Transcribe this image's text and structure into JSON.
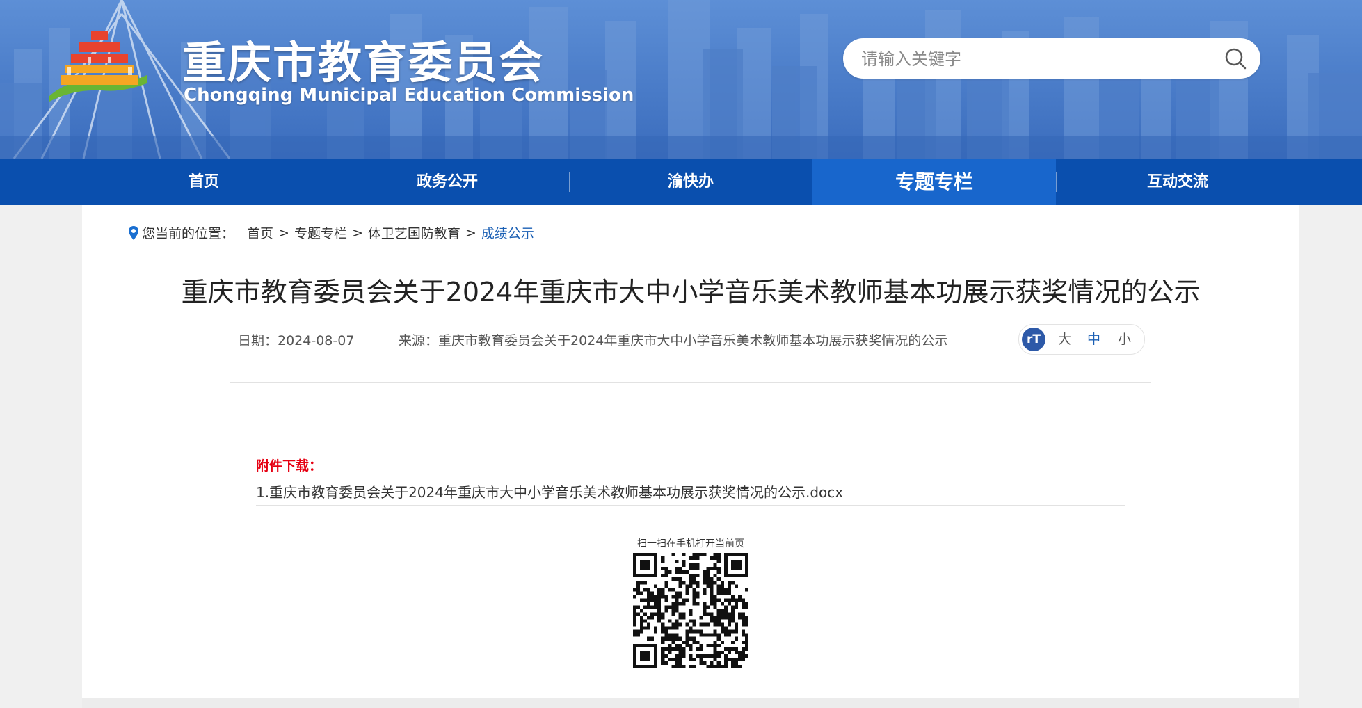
{
  "header": {
    "title": "重庆市教育委员会",
    "subtitle": "Chongqing Municipal Education Commission",
    "search_placeholder": "请输入关键字"
  },
  "nav": {
    "items": [
      {
        "label": "首页"
      },
      {
        "label": "政务公开"
      },
      {
        "label": "渝快办"
      },
      {
        "label": "专题专栏",
        "active": true
      },
      {
        "label": "互动交流"
      }
    ]
  },
  "breadcrumb": {
    "label": "您当前的位置：",
    "items": [
      "首页",
      "专题专栏",
      "体卫艺国防教育",
      "成绩公示"
    ],
    "separator": ">"
  },
  "article": {
    "title": "重庆市教育委员会关于2024年重庆市大中小学音乐美术教师基本功展示获奖情况的公示",
    "date": "日期：2024-08-07",
    "source": "来源：重庆市教育委员会关于2024年重庆市大中小学音乐美术教师基本功展示获奖情况的公示"
  },
  "font_size": {
    "big": "大",
    "medium": "中",
    "small": "小"
  },
  "attachments": {
    "label": "附件下载：",
    "files": [
      "1.重庆市教育委员会关于2024年重庆市大中小学音乐美术教师基本功展示获奖情况的公示.docx"
    ]
  },
  "qr": {
    "caption": "扫一扫在手机打开当前页"
  },
  "colors": {
    "nav_bg": "#0a4fae",
    "nav_active": "#1866cc",
    "link_blue": "#1a5fb4",
    "attach_red": "#e60012"
  }
}
